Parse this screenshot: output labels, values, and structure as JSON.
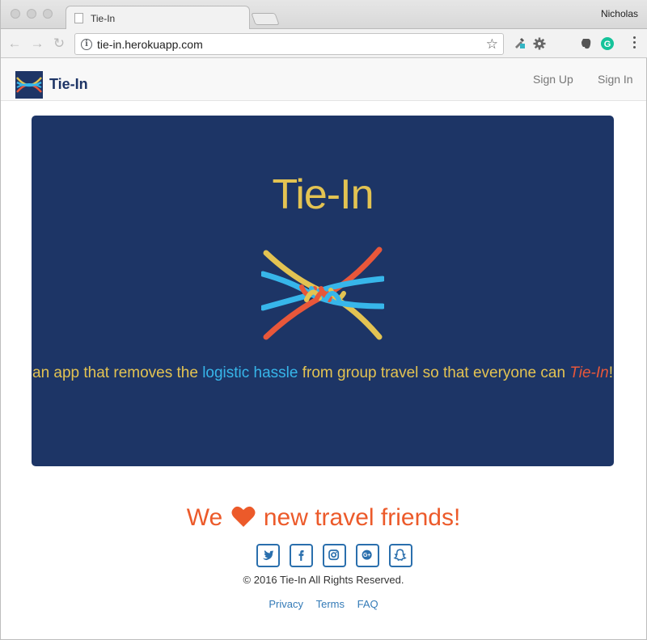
{
  "browser": {
    "tab_title": "Tie-In",
    "user": "Nicholas",
    "url": "tie-in.herokuapp.com",
    "extensions": [
      "eyedropper-icon",
      "gear-icon",
      "evernote-icon",
      "grammarly-icon"
    ]
  },
  "header": {
    "brand": "Tie-In",
    "nav": [
      {
        "label": "Sign Up"
      },
      {
        "label": "Sign In"
      }
    ]
  },
  "hero": {
    "title": "Tie-In",
    "tagline_part1": "an app that removes the ",
    "tagline_highlight": "logistic hassle",
    "tagline_part2": " from group travel so that everyone can ",
    "tagline_brand": "Tie-In",
    "tagline_end": "!",
    "colors": {
      "background": "#1d3566",
      "gold": "#e3c352",
      "blue": "#37b6ea",
      "red": "#e8573a"
    }
  },
  "footer": {
    "love_before": "We",
    "love_after": "new travel friends!",
    "socials": [
      "twitter-icon",
      "facebook-icon",
      "instagram-icon",
      "google-plus-icon",
      "snapchat-icon"
    ],
    "copyright": "© 2016 Tie-In All Rights Reserved.",
    "links": [
      "Privacy",
      "Terms",
      "FAQ"
    ],
    "colors": {
      "love": "#ec5a2a",
      "social": "#2a6fad",
      "link": "#337ab7"
    }
  }
}
